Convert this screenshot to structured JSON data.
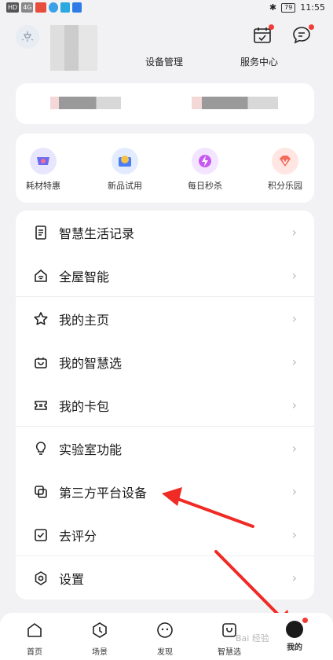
{
  "status_bar": {
    "left_chips": [
      "HD",
      "4G"
    ],
    "battery": "79",
    "time": "11:55"
  },
  "header": {
    "device_management": "设备管理",
    "service_center": "服务中心"
  },
  "promos": [
    {
      "label": "耗材特惠",
      "icon": "cart-icon",
      "color": "#6c6cf0"
    },
    {
      "label": "新品试用",
      "icon": "new-product-icon",
      "color": "#4a7df4"
    },
    {
      "label": "每日秒杀",
      "icon": "flash-sale-icon",
      "color": "#c659f0"
    },
    {
      "label": "积分乐园",
      "icon": "points-icon",
      "color": "#f46a5a"
    }
  ],
  "menu": [
    {
      "label": "智慧生活记录",
      "icon": "document-icon"
    },
    {
      "label": "全屋智能",
      "icon": "smart-home-icon"
    },
    {
      "label": "我的主页",
      "icon": "star-icon"
    },
    {
      "label": "我的智慧选",
      "icon": "shopping-bag-icon"
    },
    {
      "label": "我的卡包",
      "icon": "card-icon"
    },
    {
      "label": "实验室功能",
      "icon": "lightbulb-icon"
    },
    {
      "label": "第三方平台设备",
      "icon": "linked-devices-icon"
    },
    {
      "label": "去评分",
      "icon": "checkbox-icon"
    },
    {
      "label": "设置",
      "icon": "settings-icon"
    }
  ],
  "nav": [
    {
      "label": "首页",
      "icon": "home-icon"
    },
    {
      "label": "场景",
      "icon": "scene-icon"
    },
    {
      "label": "发现",
      "icon": "discover-icon"
    },
    {
      "label": "智慧选",
      "icon": "smart-select-icon"
    },
    {
      "label": "我的",
      "icon": "profile-icon",
      "active": true
    }
  ],
  "watermark": "Bai 经验"
}
